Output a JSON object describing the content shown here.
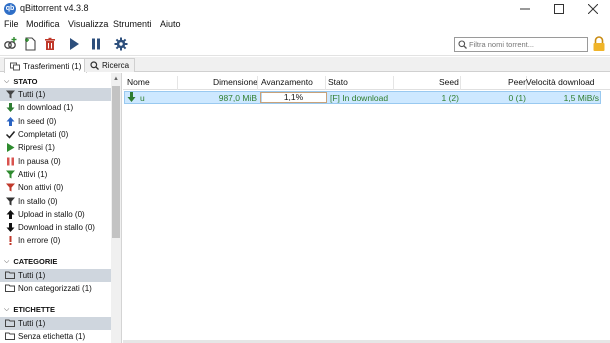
{
  "window": {
    "title": "qBittorrent v4.3.8",
    "logo_text": "qb"
  },
  "menu": [
    "File",
    "Modifica",
    "Visualizza",
    "Strumenti",
    "Aiuto"
  ],
  "search": {
    "placeholder": "Filtra nomi torrent..."
  },
  "tabs": [
    {
      "label": "Trasferimenti (1)",
      "active": true
    },
    {
      "label": "Ricerca",
      "active": false
    }
  ],
  "sidebar": {
    "sections": [
      {
        "title": "STATO",
        "items": [
          {
            "label": "Tutti (1)",
            "icon": "filter-icon",
            "selected": true
          },
          {
            "label": "In download (1)",
            "icon": "download-arrow-icon"
          },
          {
            "label": "In seed (0)",
            "icon": "upload-arrow-icon"
          },
          {
            "label": "Completati (0)",
            "icon": "checkmark-icon"
          },
          {
            "label": "Ripresi (1)",
            "icon": "play-icon"
          },
          {
            "label": "In pausa (0)",
            "icon": "pause-icon"
          },
          {
            "label": "Attivi (1)",
            "icon": "active-filter-icon"
          },
          {
            "label": "Non attivi (0)",
            "icon": "inactive-filter-icon"
          },
          {
            "label": "In stallo (0)",
            "icon": "stalled-filter-icon"
          },
          {
            "label": "Upload in stallo (0)",
            "icon": "upload-stalled-icon"
          },
          {
            "label": "Download in stallo (0)",
            "icon": "download-stalled-icon"
          },
          {
            "label": "In errore (0)",
            "icon": "error-icon"
          }
        ]
      },
      {
        "title": "CATEGORIE",
        "items": [
          {
            "label": "Tutti (1)",
            "icon": "folder-icon",
            "selected": true
          },
          {
            "label": "Non categorizzati (1)",
            "icon": "folder-icon"
          }
        ]
      },
      {
        "title": "ETICHETTE",
        "items": [
          {
            "label": "Tutti (1)",
            "icon": "folder-icon",
            "selected": true
          },
          {
            "label": "Senza etichetta (1)",
            "icon": "folder-icon"
          }
        ]
      }
    ]
  },
  "table": {
    "columns": [
      "Nome",
      "Dimensione",
      "Avanzamento",
      "Stato",
      "Seed",
      "Peer",
      "Velocità download"
    ],
    "rows": [
      {
        "name": "u",
        "size": "987,0 MiB",
        "progress_text": "1,1%",
        "progress": 0.011,
        "status": "[F] In download",
        "seeds": "1 (2)",
        "peers": "0 (1)",
        "dl_speed": "1,5 MiB/s"
      }
    ]
  },
  "colors": {
    "selection": "#cde8ff",
    "downloading_text": "#2f7e2f",
    "sidebar_selected": "#cfd6de"
  }
}
